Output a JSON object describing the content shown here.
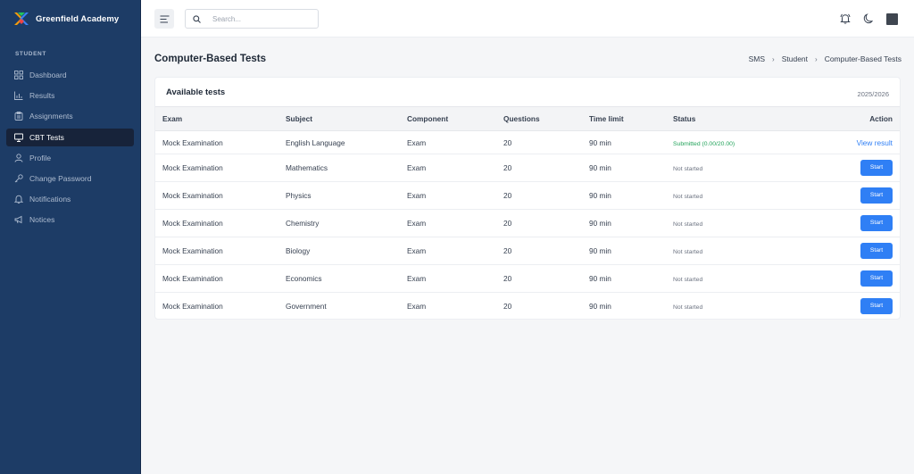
{
  "brand": {
    "name": "Greenfield Academy"
  },
  "sidebar": {
    "section_label": "STUDENT",
    "items": [
      {
        "label": "Dashboard",
        "icon": "dashboard-icon"
      },
      {
        "label": "Results",
        "icon": "bar-chart-icon"
      },
      {
        "label": "Assignments",
        "icon": "clipboard-icon"
      },
      {
        "label": "CBT Tests",
        "icon": "monitor-icon",
        "active": true
      },
      {
        "label": "Profile",
        "icon": "user-icon"
      },
      {
        "label": "Change Password",
        "icon": "key-icon"
      },
      {
        "label": "Notifications",
        "icon": "bell-icon"
      },
      {
        "label": "Notices",
        "icon": "megaphone-icon"
      }
    ]
  },
  "topbar": {
    "search_placeholder": "Search..."
  },
  "page": {
    "title": "Computer-Based Tests",
    "breadcrumb": [
      "SMS",
      "Student",
      "Computer-Based Tests"
    ]
  },
  "card": {
    "title": "Available tests",
    "year": "2025/2026"
  },
  "table": {
    "headers": {
      "exam": "Exam",
      "subject": "Subject",
      "component": "Component",
      "questions": "Questions",
      "time": "Time limit",
      "status": "Status",
      "action": "Action"
    },
    "rows": [
      {
        "exam": "Mock Examination",
        "subject": "English Language",
        "component": "Exam",
        "questions": "20",
        "time": "90 min",
        "status": "Submitted (0.00/20.00)",
        "action": "View result"
      },
      {
        "exam": "Mock Examination",
        "subject": "Mathematics",
        "component": "Exam",
        "questions": "20",
        "time": "90 min",
        "status": "Not started",
        "action": "Start"
      },
      {
        "exam": "Mock Examination",
        "subject": "Physics",
        "component": "Exam",
        "questions": "20",
        "time": "90 min",
        "status": "Not started",
        "action": "Start"
      },
      {
        "exam": "Mock Examination",
        "subject": "Chemistry",
        "component": "Exam",
        "questions": "20",
        "time": "90 min",
        "status": "Not started",
        "action": "Start"
      },
      {
        "exam": "Mock Examination",
        "subject": "Biology",
        "component": "Exam",
        "questions": "20",
        "time": "90 min",
        "status": "Not started",
        "action": "Start"
      },
      {
        "exam": "Mock Examination",
        "subject": "Economics",
        "component": "Exam",
        "questions": "20",
        "time": "90 min",
        "status": "Not started",
        "action": "Start"
      },
      {
        "exam": "Mock Examination",
        "subject": "Government",
        "component": "Exam",
        "questions": "20",
        "time": "90 min",
        "status": "Not started",
        "action": "Start"
      }
    ]
  },
  "colors": {
    "sidebar_bg": "#1d3c66",
    "accent": "#2f7ff5",
    "success": "#22a35a"
  }
}
